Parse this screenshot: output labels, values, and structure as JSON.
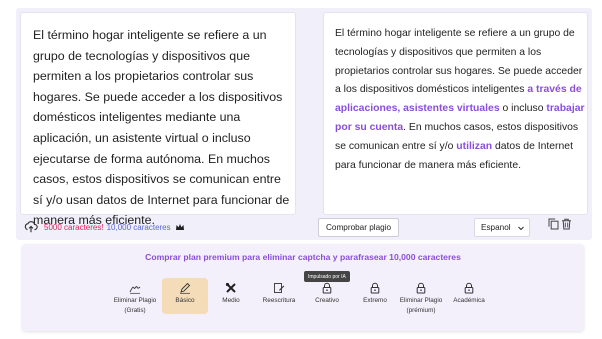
{
  "input": {
    "text": "El término hogar inteligente se refiere a un grupo de tecnologías y dispositivos que permiten a los propietarios controlar sus hogares. Se puede acceder a los dispositivos domésticos inteligentes mediante una aplicación, un asistente virtual o incluso ejecutarse de forma autónoma. En muchos casos, estos dispositivos se comunican entre sí y/o usan datos de Internet para funcionar de manera más eficiente."
  },
  "output": {
    "part1": "El término hogar inteligente se refiere a un grupo de tecnologías y dispositivos que permiten a los propietarios controlar sus hogares. Se puede acceder a los dispositivos domésticos inteligentes ",
    "hl1": "a través de aplicaciones, asistentes virtuales",
    "part2": " o incluso ",
    "hl2": "trabajar por su cuenta",
    "part3": ". En muchos casos, estos dispositivos se comunican entre sí y/o ",
    "hl3": "utilizan",
    "part4": " datos de Internet para funcionar de manera más eficiente."
  },
  "footer": {
    "count_used": "5000 caracteres!",
    "count_limit": "10,000 caracteres",
    "check_button": "Comprobar plagio",
    "language": "Espanol"
  },
  "premium": {
    "link": "Comprar plan premium para eliminar captcha y parafrasear 10,000 caracteres",
    "badge": "Impulsado por IA"
  },
  "modes": [
    {
      "label": "Eliminar Plagio",
      "sub": "(Gratis)"
    },
    {
      "label": "Básico",
      "sub": ""
    },
    {
      "label": "Medio",
      "sub": ""
    },
    {
      "label": "Reescritura",
      "sub": ""
    },
    {
      "label": "Creativo",
      "sub": ""
    },
    {
      "label": "Extremo",
      "sub": ""
    },
    {
      "label": "Eliminar Plagio",
      "sub": "(prémium)"
    },
    {
      "label": "Académica",
      "sub": ""
    }
  ],
  "colors": {
    "accent": "#8a4fd6",
    "active_mode": "#f4dcb8",
    "warning": "#e0245e"
  }
}
